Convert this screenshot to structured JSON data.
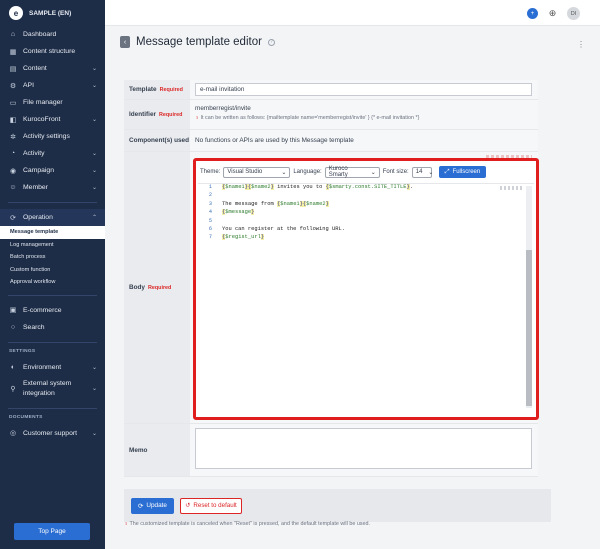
{
  "brand": {
    "logo_letter": "e",
    "site_name": "SAMPLE (EN)"
  },
  "sidebar": {
    "items": [
      {
        "label": "Dashboard",
        "icon": "home-icon",
        "chev": ""
      },
      {
        "label": "Content structure",
        "icon": "grid-icon",
        "chev": ""
      },
      {
        "label": "Content",
        "icon": "doc-icon",
        "chev": "⌄"
      },
      {
        "label": "API",
        "icon": "api-icon",
        "chev": "⌄"
      },
      {
        "label": "File manager",
        "icon": "folder-icon",
        "chev": ""
      },
      {
        "label": "KurocoFront",
        "icon": "front-icon",
        "chev": "⌄"
      },
      {
        "label": "Activity settings",
        "icon": "gear-icon",
        "chev": ""
      },
      {
        "label": "Activity",
        "icon": "activity-icon",
        "chev": "⌄"
      },
      {
        "label": "Campaign",
        "icon": "campaign-icon",
        "chev": "⌄"
      },
      {
        "label": "Member",
        "icon": "member-icon",
        "chev": "⌄"
      }
    ],
    "operation": {
      "label": "Operation",
      "chev": "⌃"
    },
    "operation_sub": [
      "Message template",
      "Log management",
      "Batch process",
      "Custom function",
      "Approval workflow"
    ],
    "items2": [
      {
        "label": "E-commerce",
        "chev": ""
      },
      {
        "label": "Search",
        "chev": ""
      }
    ],
    "settings_label": "SETTINGS",
    "environment": {
      "label": "Environment",
      "chev": "⌄"
    },
    "external": {
      "label1": "External system",
      "label2": "integration",
      "chev": "⌄"
    },
    "documents_label": "DOCUMENTS",
    "support": {
      "label": "Customer support",
      "chev": "⌄"
    },
    "top_page": "Top Page"
  },
  "header": {
    "avatar": "DI",
    "plus": "+",
    "globe": "⊕"
  },
  "page": {
    "title": "Message template editor",
    "back": "‹",
    "help": "?",
    "kebab": "⋮"
  },
  "form": {
    "template_label": "Template",
    "required": "Required",
    "template_value": "e-mail invitation",
    "identifier_label": "Identifier",
    "identifier_value": "memberregist/invite",
    "identifier_hint": "It can be written as follows: {mailtemplate name='memberregist/invite' } {* e-mail invitation *}",
    "components_label": "Component(s) used",
    "components_value": "No functions or APIs are used by this Message template",
    "body_label": "Body",
    "memo_label": "Memo"
  },
  "editor": {
    "theme_label": "Theme:",
    "theme_value": "Visual Studio",
    "language_label": "Language:",
    "language_value": "Kuroco Smarty",
    "fontsize_label": "Font size:",
    "fontsize_value": "14",
    "fullscreen": "Fullscreen",
    "line_numbers": [
      "1",
      "2",
      "3",
      "4",
      "5",
      "6",
      "7"
    ]
  },
  "actions": {
    "update": "Update",
    "reset": "Reset to default"
  },
  "footnote": "The customized template is canceled when \"Reset\" is pressed, and the default template will be used.",
  "colors": {
    "sidebar": "#1e2d47",
    "accent": "#2b6ed3",
    "danger": "#dc2626"
  }
}
